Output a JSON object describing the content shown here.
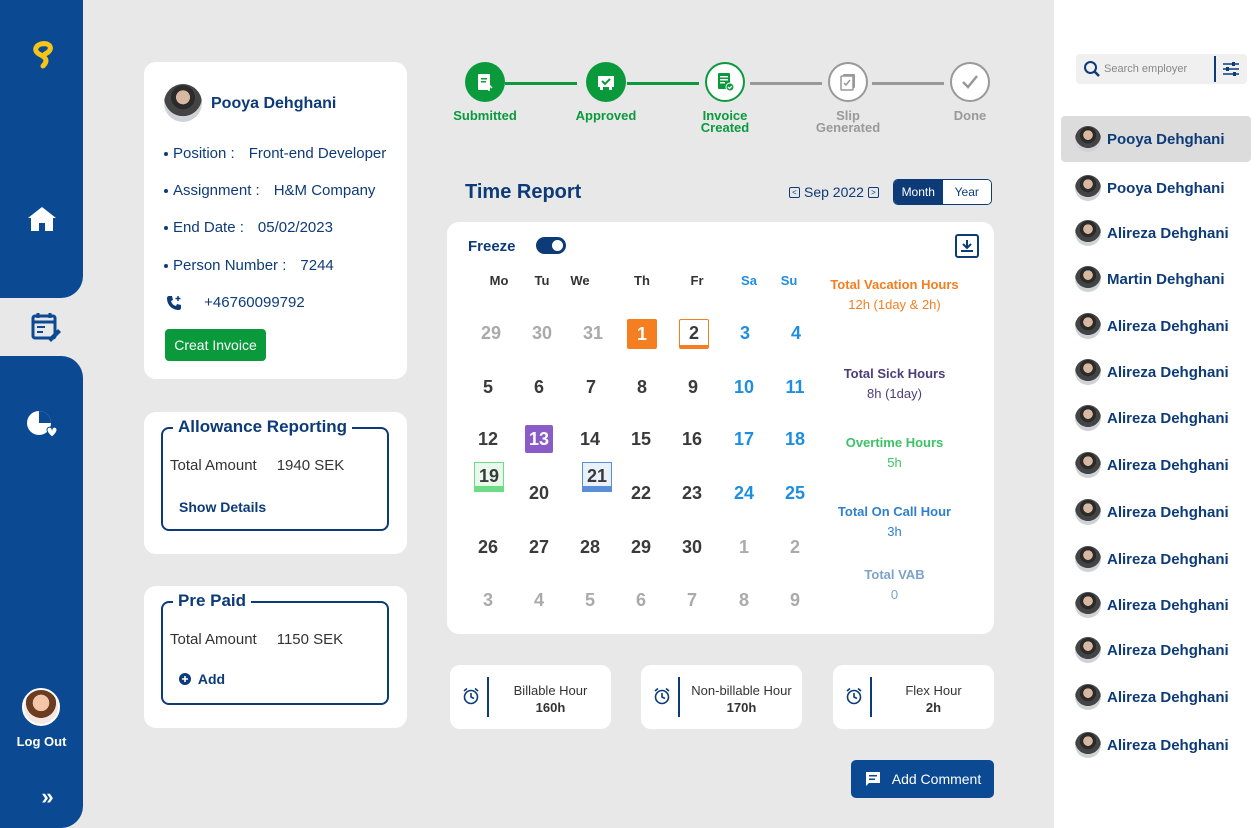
{
  "colors": {
    "primary": "#0b4a92",
    "success": "#0a9a3c",
    "weekend": "#1e8fe0",
    "orange": "#f47e20"
  },
  "sidebar": {
    "logout_label": "Log Out",
    "nav_icons": [
      "logo-icon",
      "home-icon",
      "timesheet-icon",
      "health-icon"
    ]
  },
  "profile": {
    "name": "Pooya Dehghani",
    "position_label": "Position :",
    "position": "Front-end Developer",
    "assignment_label": "Assignment :",
    "assignment": "H&M Company",
    "end_date_label": "End Date :",
    "end_date": "05/02/2023",
    "person_number_label": "Person Number :",
    "person_number": "7244",
    "phone": "+46760099792",
    "create_invoice": "Creat Invoice"
  },
  "allowance": {
    "title": "Allowance Reporting",
    "amount_label": "Total Amount",
    "amount": "1940 SEK",
    "link": "Show Details"
  },
  "prepaid": {
    "title": "Pre Paid",
    "amount_label": "Total Amount",
    "amount": "1150 SEK",
    "link": "Add"
  },
  "steps": [
    {
      "label1": "Submitted",
      "label2": "",
      "state": "done"
    },
    {
      "label1": "Approved",
      "label2": "",
      "state": "done"
    },
    {
      "label1": "Invoice",
      "label2": "Created",
      "state": "current"
    },
    {
      "label1": "Slip",
      "label2": "Generated",
      "state": "todo"
    },
    {
      "label1": "Done",
      "label2": "",
      "state": "todo"
    }
  ],
  "time_report": {
    "title": "Time Report",
    "month": "Sep 2022",
    "view_month": "Month",
    "view_year": "Year",
    "freeze_label": "Freeze",
    "freeze_on": true,
    "weekdays": [
      "Mo",
      "Tu",
      "We",
      "Th",
      "Fr",
      "Sa",
      "Su"
    ],
    "weeks": [
      [
        "29",
        "30",
        "31",
        "1",
        "2",
        "3",
        "4"
      ],
      [
        "5",
        "6",
        "7",
        "8",
        "9",
        "10",
        "11"
      ],
      [
        "12",
        "13",
        "14",
        "15",
        "16",
        "17",
        "18"
      ],
      [
        "19",
        "20",
        "21",
        "22",
        "23",
        "24",
        "25"
      ],
      [
        "26",
        "27",
        "28",
        "29",
        "30",
        "1",
        "2"
      ],
      [
        "3",
        "4",
        "5",
        "6",
        "7",
        "8",
        "9"
      ]
    ],
    "stats": [
      {
        "label": "Total Vacation Hours",
        "value": "12h (1day & 2h)",
        "color": "#f47e20"
      },
      {
        "label": "Total Sick Hours",
        "value": "8h (1day)",
        "color": "#4b3f7a"
      },
      {
        "label": "Overtime Hours",
        "value": "5h",
        "color": "#3cc265"
      },
      {
        "label": "Total On Call Hour",
        "value": "3h",
        "color": "#2f7fd0"
      },
      {
        "label": "Total VAB",
        "value": "0",
        "color": "#7da3c8"
      }
    ],
    "summary": [
      {
        "label": "Billable Hour",
        "value": "160h"
      },
      {
        "label": "Non-billable Hour",
        "value": "170h"
      },
      {
        "label": "Flex Hour",
        "value": "2h"
      }
    ],
    "add_comment": "Add Comment"
  },
  "employees": {
    "search_placeholder": "Search employer",
    "list": [
      "Pooya Dehghani",
      "Pooya Dehghani",
      "Alireza Dehghani",
      "Martin Dehghani",
      "Alireza Dehghani",
      "Alireza Dehghani",
      "Alireza Dehghani",
      "Alireza Dehghani",
      "Alireza Dehghani",
      "Alireza Dehghani",
      "Alireza Dehghani",
      "Alireza Dehghani",
      "Alireza Dehghani",
      "Alireza Dehghani"
    ],
    "selected_index": 0
  }
}
